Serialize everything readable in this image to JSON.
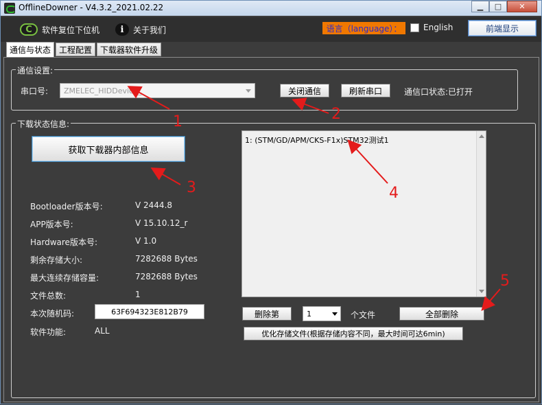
{
  "window": {
    "title": "OfflineDowner - V4.3.2_2021.02.22"
  },
  "menu": {
    "reset_label": "软件复位下位机",
    "about_label": "关于我们",
    "language_label": "语言（language）：",
    "english_label": "English",
    "front_button": "前端显示"
  },
  "tabs": [
    {
      "label": "通信与状态"
    },
    {
      "label": "工程配置"
    },
    {
      "label": "下载器软件升级"
    }
  ],
  "comm": {
    "group_title": "通信设置:",
    "port_label": "串口号:",
    "port_value": "ZMELEC_HIDDevice_",
    "close_button": "关闭通信",
    "refresh_button": "刷新串口",
    "status_text": "通信口状态:已打开"
  },
  "download": {
    "group_title": "下载状态信息:",
    "fetch_button": "获取下载器内部信息",
    "info": [
      {
        "label": "Bootloader版本号:",
        "value": "V 2444.8"
      },
      {
        "label": "APP版本号:",
        "value": "V 15.10.12_r"
      },
      {
        "label": "Hardware版本号:",
        "value": "V 1.0"
      },
      {
        "label": "剩余存储大小:",
        "value": "7282688 Bytes"
      },
      {
        "label": "最大连续存储容量:",
        "value": "7282688 Bytes"
      },
      {
        "label": "文件总数:",
        "value": "1"
      }
    ],
    "random_code_label": "本次随机码:",
    "random_code_value": "63F694323E812B79",
    "function_label": "软件功能:",
    "function_value": "ALL",
    "file_list": [
      "1: (STM/GD/APM/CKS-F1x)STM32测试1"
    ],
    "delete_button": "删除第",
    "delete_index": "1",
    "file_unit": "个文件",
    "delete_all_button": "全部删除",
    "optimize_button": "优化存储文件(根据存储内容不同，最大时间可达6min)"
  },
  "annotations": [
    "1",
    "2",
    "3",
    "4",
    "5"
  ],
  "colors": {
    "annotation": "#e41b1b",
    "language_bg": "#f07800",
    "panel_bg": "#3c3c3c"
  }
}
